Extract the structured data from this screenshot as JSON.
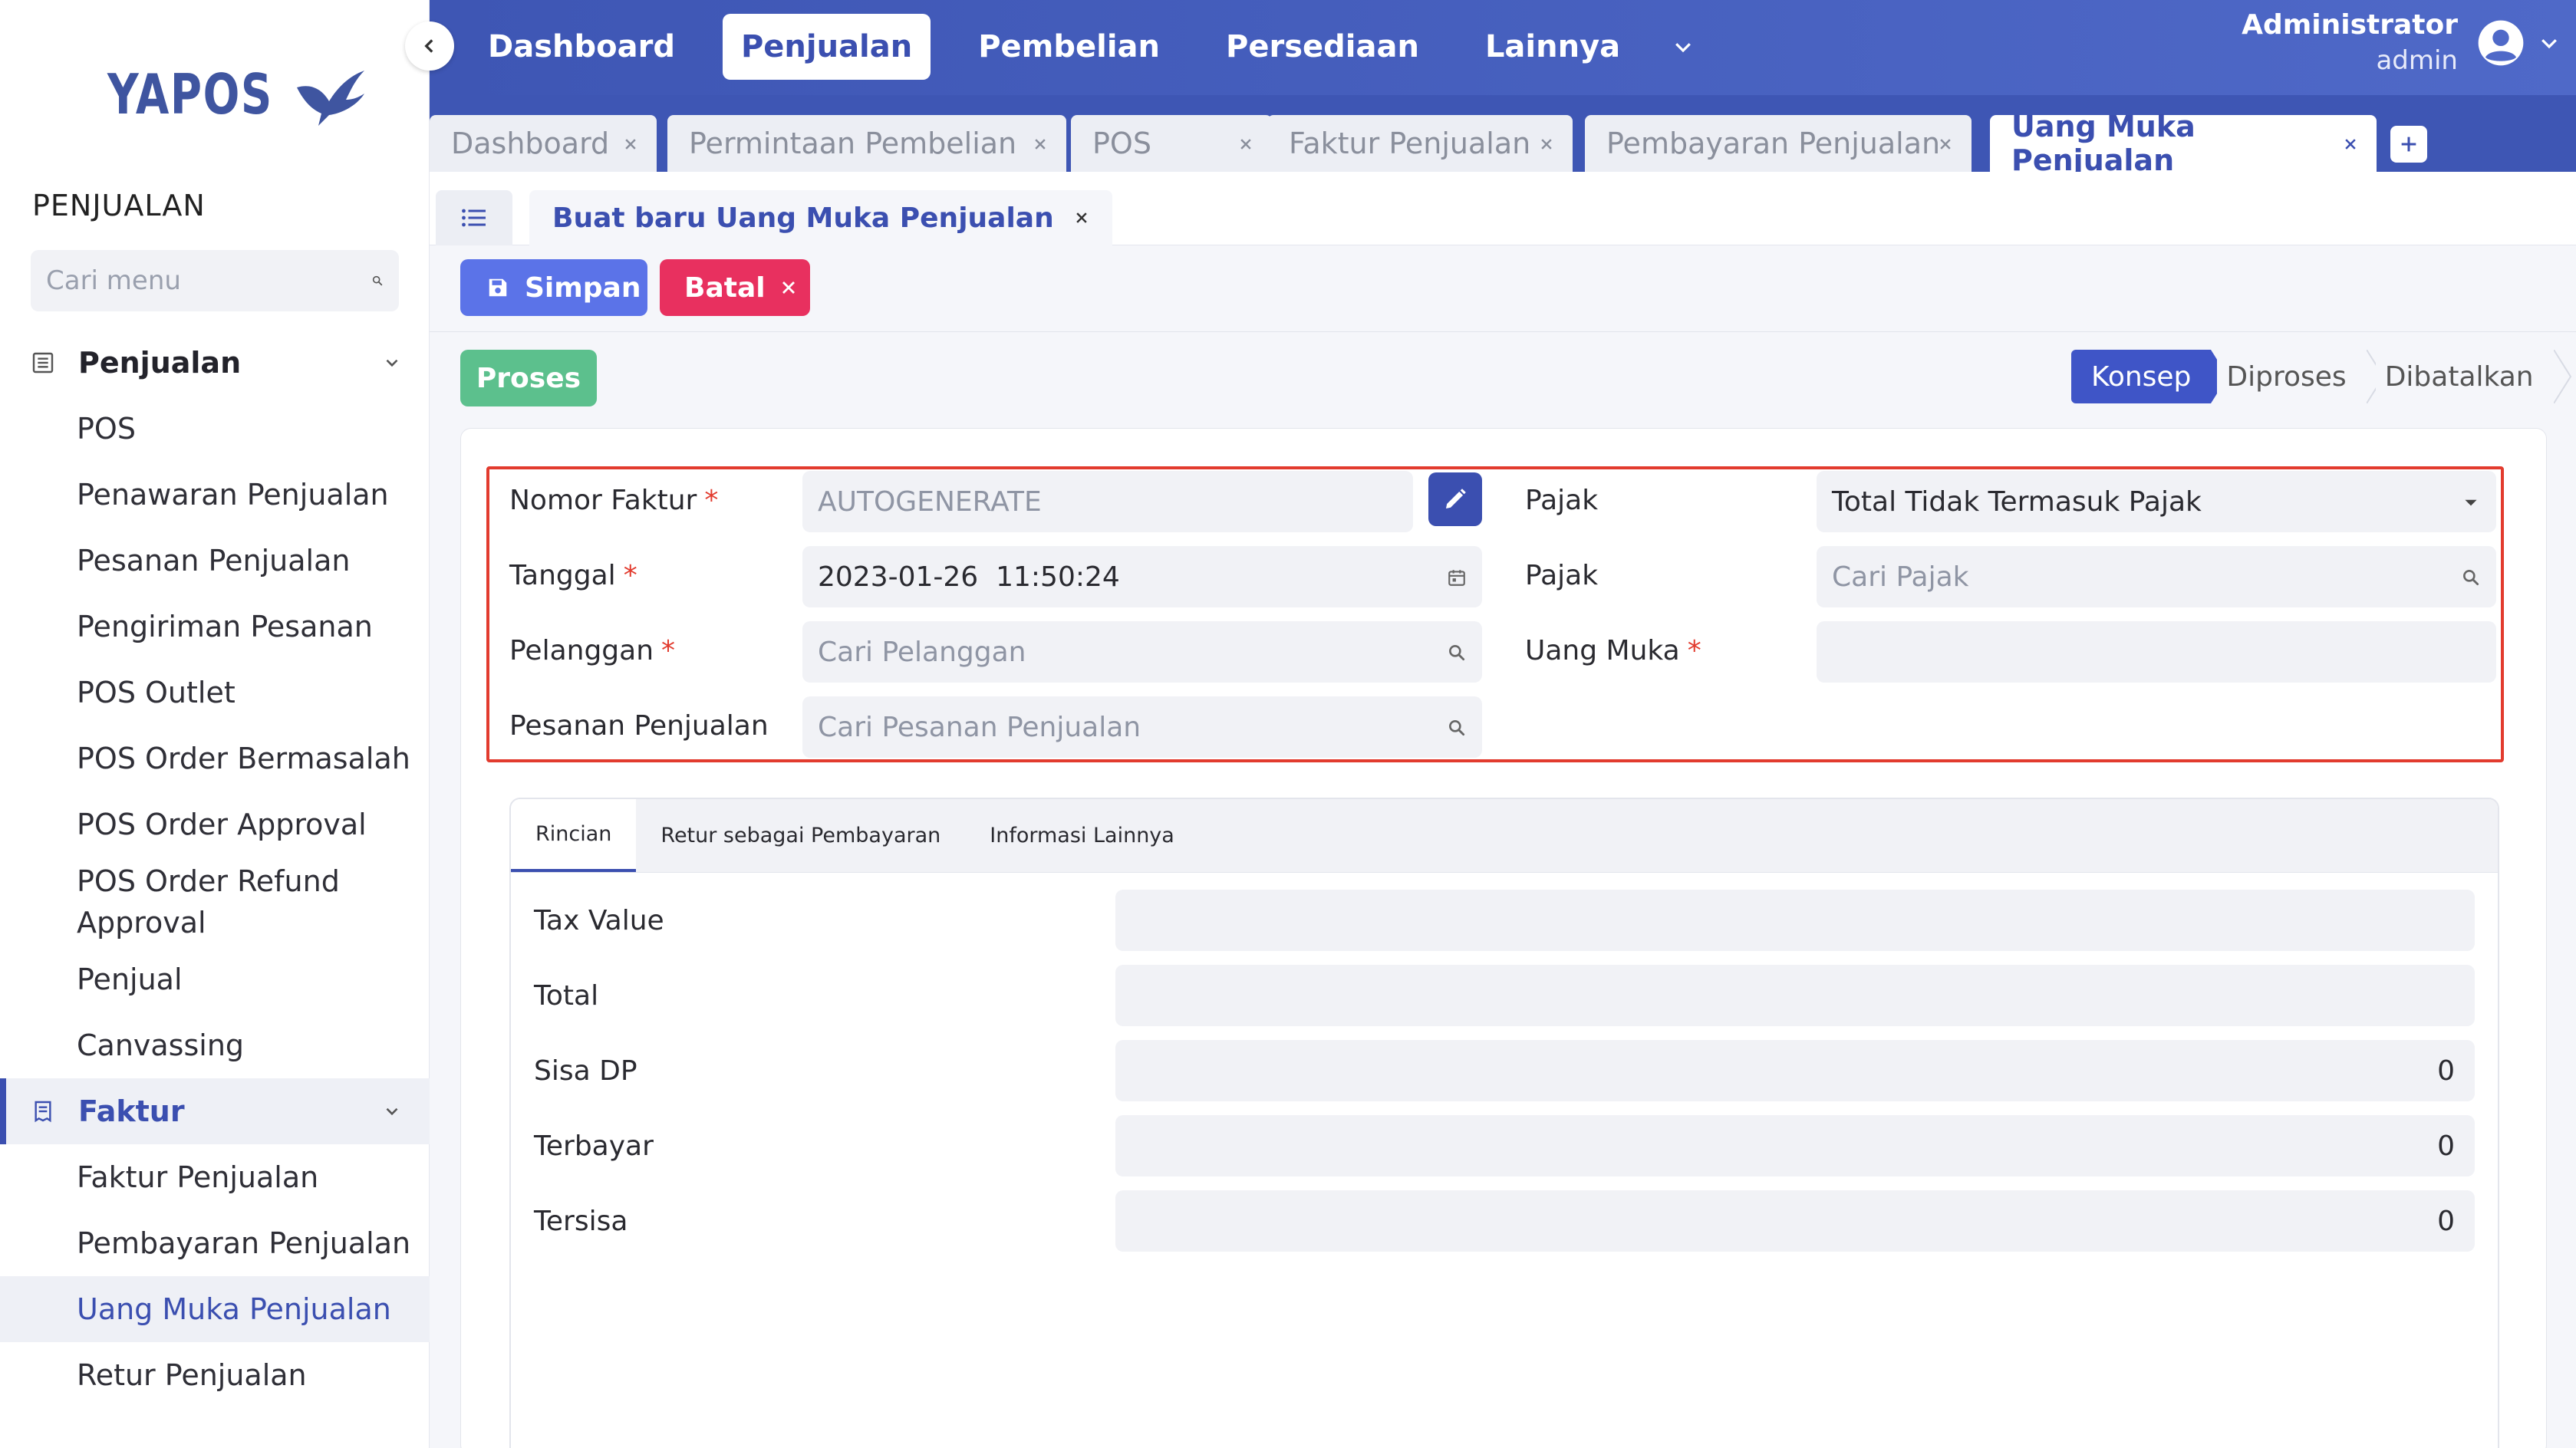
{
  "app": {
    "brand": "YAPOS"
  },
  "sidebar": {
    "section_title": "PENJUALAN",
    "search_placeholder": "Cari menu",
    "group_penjualan": "Penjualan",
    "items_penjualan": [
      "POS",
      "Penawaran Penjualan",
      "Pesanan Penjualan",
      "Pengiriman Pesanan",
      "POS Outlet",
      "POS Order Bermasalah",
      "POS Order Approval",
      "POS Order Refund Approval",
      "Penjual",
      "Canvassing"
    ],
    "group_faktur": "Faktur",
    "items_faktur": [
      "Faktur Penjualan",
      "Pembayaran Penjualan",
      "Uang Muka Penjualan",
      "Retur Penjualan"
    ]
  },
  "topnav": {
    "items": [
      "Dashboard",
      "Penjualan",
      "Pembelian",
      "Persediaan",
      "Lainnya"
    ],
    "active": "Penjualan",
    "user_name": "Administrator",
    "user_role": "admin"
  },
  "doc_tabs": [
    "Dashboard",
    "Permintaan Pembelian",
    "POS",
    "Faktur Penjualan",
    "Pembayaran Penjualan",
    "Uang Muka Penjualan"
  ],
  "subtab": {
    "label": "Buat baru Uang Muka Penjualan"
  },
  "actions": {
    "save": "Simpan",
    "cancel": "Batal",
    "process": "Proses"
  },
  "status_steps": [
    "Konsep",
    "Diproses",
    "Dibatalkan"
  ],
  "form": {
    "nomor_faktur": {
      "label": "Nomor Faktur",
      "value": "AUTOGENERATE"
    },
    "tanggal": {
      "label": "Tanggal",
      "value": "2023-01-26  11:50:24"
    },
    "pelanggan": {
      "label": "Pelanggan",
      "placeholder": "Cari Pelanggan"
    },
    "pesanan": {
      "label": "Pesanan Penjualan",
      "placeholder": "Cari Pesanan Penjualan"
    },
    "pajak_type": {
      "label": "Pajak",
      "value": "Total Tidak Termasuk Pajak"
    },
    "pajak": {
      "label": "Pajak",
      "placeholder": "Cari Pajak"
    },
    "uang_muka": {
      "label": "Uang Muka",
      "value": ""
    },
    "required_mark": "*"
  },
  "detail": {
    "tabs": [
      "Rincian",
      "Retur sebagai Pembayaran",
      "Informasi Lainnya"
    ],
    "rows": [
      {
        "label": "Tax Value",
        "value": ""
      },
      {
        "label": "Total",
        "value": ""
      },
      {
        "label": "Sisa DP",
        "value": "0"
      },
      {
        "label": "Terbayar",
        "value": "0"
      },
      {
        "label": "Tersisa",
        "value": "0"
      }
    ]
  },
  "colors": {
    "primary": "#3b4fb0",
    "save": "#5b73e8",
    "cancel": "#e8305f",
    "process": "#5cc08d",
    "highlight": "#e23b2e"
  }
}
